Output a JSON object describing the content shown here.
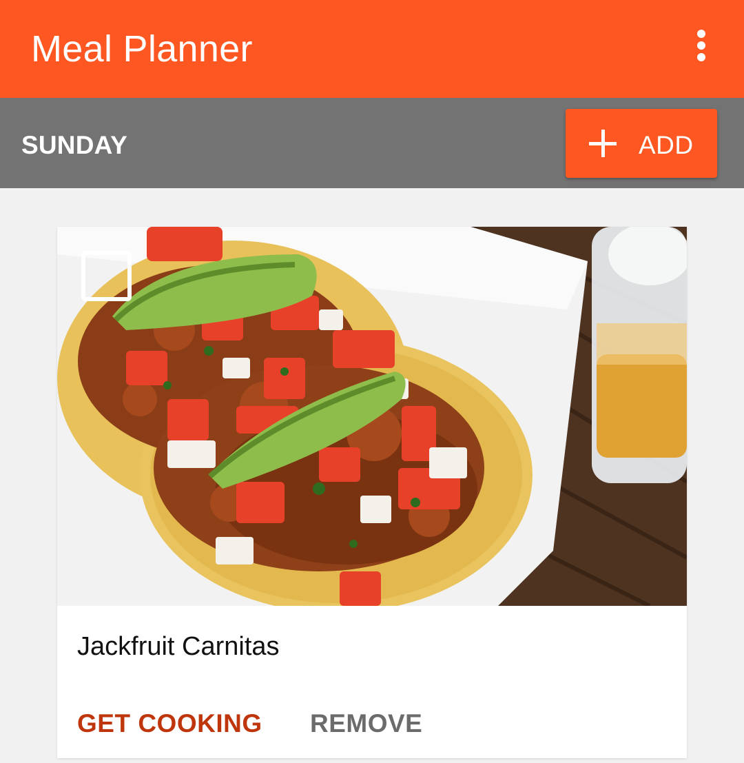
{
  "app_bar": {
    "title": "Meal Planner",
    "menu_icon": "more-vert-icon",
    "color": "#ff5722"
  },
  "day_header": {
    "day": "SUNDAY",
    "add_label": "ADD",
    "add_icon": "plus-icon",
    "background": "#737373"
  },
  "meal_card": {
    "image_alt": "Jackfruit Carnitas",
    "recipe_name": "Jackfruit Carnitas",
    "primary_action": "GET COOKING",
    "secondary_action": "REMOVE",
    "checkbox_checked": false,
    "primary_action_color": "#bf360c"
  }
}
